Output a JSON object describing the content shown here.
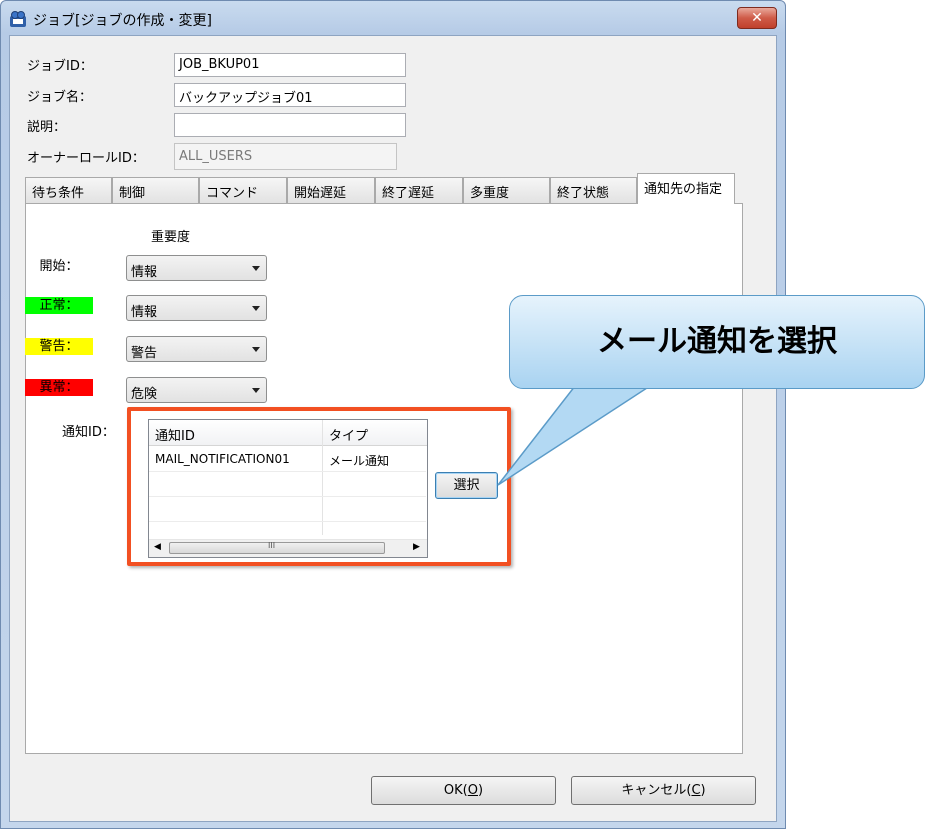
{
  "window": {
    "title": "ジョブ[ジョブの作成・変更]",
    "close_glyph": "✕"
  },
  "form": {
    "job_id_label": "ジョブID：",
    "job_id_value": "JOB_BKUP01",
    "job_name_label": "ジョブ名：",
    "job_name_value": "バックアップジョブ01",
    "description_label": "説明：",
    "description_value": "",
    "owner_role_label": "オーナーロールID：",
    "owner_role_value": "ALL_USERS"
  },
  "tabs": [
    {
      "label": "待ち条件",
      "active": false
    },
    {
      "label": "制御",
      "active": false
    },
    {
      "label": "コマンド",
      "active": false
    },
    {
      "label": "開始遅延",
      "active": false
    },
    {
      "label": "終了遅延",
      "active": false
    },
    {
      "label": "多重度",
      "active": false
    },
    {
      "label": "終了状態",
      "active": false
    },
    {
      "label": "通知先の指定",
      "active": true
    }
  ],
  "notify": {
    "importance_header": "重要度",
    "rows": [
      {
        "label": "開始：",
        "color": "",
        "value": "情報"
      },
      {
        "label": "正常：",
        "color": "#00ff00",
        "value": "情報"
      },
      {
        "label": "警告：",
        "color": "#ffff00",
        "value": "警告"
      },
      {
        "label": "異常：",
        "color": "#ff0000",
        "value": "危険"
      }
    ],
    "notify_id_label": "通知ID：",
    "table": {
      "columns": [
        "通知ID",
        "タイプ"
      ],
      "rows": [
        [
          "MAIL_NOTIFICATION01",
          "メール通知"
        ]
      ]
    },
    "select_button": "選択",
    "scroll_grip": "III"
  },
  "footer": {
    "ok_label": "OK(",
    "ok_key": "O",
    "ok_tail": ")",
    "cancel_label": "キャンセル(",
    "cancel_key": "C",
    "cancel_tail": ")"
  },
  "annotation": {
    "callout_text": "メール通知を選択",
    "highlight_color": "#f25022"
  }
}
